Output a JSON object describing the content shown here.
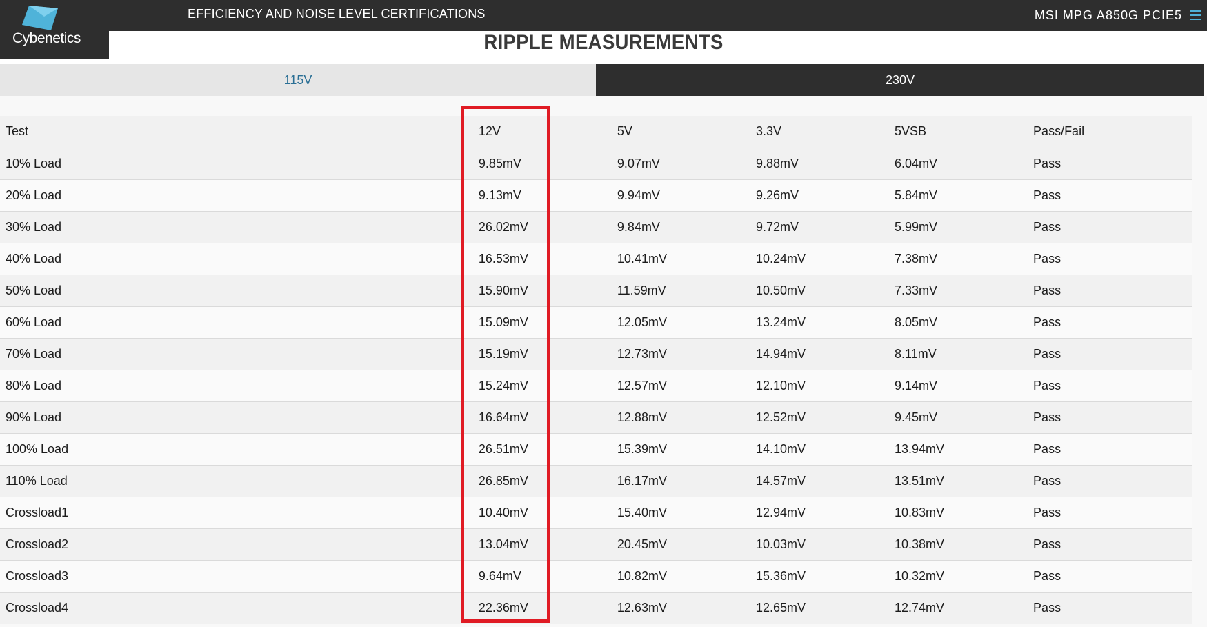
{
  "topbar": {
    "logo_text": "Cybenetics",
    "title": "EFFICIENCY AND NOISE LEVEL CERTIFICATIONS",
    "product": "MSI MPG A850G PCIE5",
    "menu_icon": "hamburger-menu-icon"
  },
  "heading": "RIPPLE MEASUREMENTS",
  "tabs": [
    {
      "label": "115V",
      "active": false
    },
    {
      "label": "230V",
      "active": true
    }
  ],
  "colors": {
    "highlight": "#e01b24",
    "bar_dark": "#2e2e2e",
    "tab_inactive_text": "#2a6f95",
    "logo_accent": "#4fb3d9"
  },
  "table": {
    "headers": [
      "Test",
      "12V",
      "5V",
      "3.3V",
      "5VSB",
      "Pass/Fail"
    ],
    "rows": [
      [
        "10% Load",
        "9.85mV",
        "9.07mV",
        "9.88mV",
        "6.04mV",
        "Pass"
      ],
      [
        "20% Load",
        "9.13mV",
        "9.94mV",
        "9.26mV",
        "5.84mV",
        "Pass"
      ],
      [
        "30% Load",
        "26.02mV",
        "9.84mV",
        "9.72mV",
        "5.99mV",
        "Pass"
      ],
      [
        "40% Load",
        "16.53mV",
        "10.41mV",
        "10.24mV",
        "7.38mV",
        "Pass"
      ],
      [
        "50% Load",
        "15.90mV",
        "11.59mV",
        "10.50mV",
        "7.33mV",
        "Pass"
      ],
      [
        "60% Load",
        "15.09mV",
        "12.05mV",
        "13.24mV",
        "8.05mV",
        "Pass"
      ],
      [
        "70% Load",
        "15.19mV",
        "12.73mV",
        "14.94mV",
        "8.11mV",
        "Pass"
      ],
      [
        "80% Load",
        "15.24mV",
        "12.57mV",
        "12.10mV",
        "9.14mV",
        "Pass"
      ],
      [
        "90% Load",
        "16.64mV",
        "12.88mV",
        "12.52mV",
        "9.45mV",
        "Pass"
      ],
      [
        "100% Load",
        "26.51mV",
        "15.39mV",
        "14.10mV",
        "13.94mV",
        "Pass"
      ],
      [
        "110% Load",
        "26.85mV",
        "16.17mV",
        "14.57mV",
        "13.51mV",
        "Pass"
      ],
      [
        "Crossload1",
        "10.40mV",
        "15.40mV",
        "12.94mV",
        "10.83mV",
        "Pass"
      ],
      [
        "Crossload2",
        "13.04mV",
        "20.45mV",
        "10.03mV",
        "10.38mV",
        "Pass"
      ],
      [
        "Crossload3",
        "9.64mV",
        "10.82mV",
        "15.36mV",
        "10.32mV",
        "Pass"
      ],
      [
        "Crossload4",
        "22.36mV",
        "12.63mV",
        "12.65mV",
        "12.74mV",
        "Pass"
      ]
    ]
  }
}
